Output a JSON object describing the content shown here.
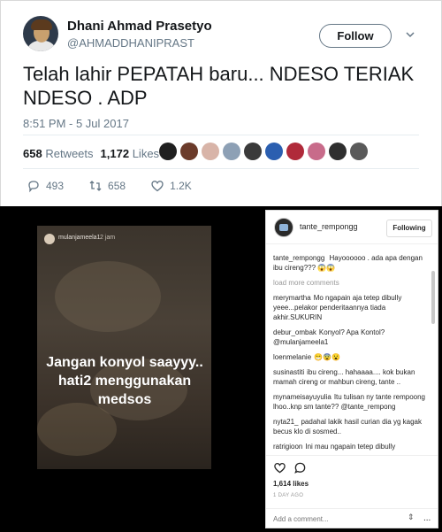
{
  "tweet": {
    "name": "Dhani Ahmad Prasetyo",
    "handle": "@AHMADDHANIPRAST",
    "follow_label": "Follow",
    "text": "Telah lahir PEPATAH baru... NDESO TERIAK NDESO . ADP",
    "timestamp": "8:51 PM - 5 Jul 2017",
    "retweets_count": "658",
    "retweets_label": "Retweets",
    "likes_count": "1,172",
    "likes_label": "Likes",
    "reply_count": "493",
    "retweet_count": "658",
    "like_count": "1.2K",
    "liker_colors": [
      "#1f1f1f",
      "#6b3b2a",
      "#d8b4a8",
      "#8da0b5",
      "#3a3a3a",
      "#2b5fb0",
      "#b02a3a",
      "#c86b8a",
      "#2f2f2f",
      "#5a5a5a"
    ]
  },
  "story": {
    "user": "mulanjameela1",
    "time": "2 jam",
    "text": "Jangan konyol saayyy.. hati2 menggunakan medsos"
  },
  "instagram": {
    "user": "tante_rempongg",
    "following_label": "Following",
    "first_comment": {
      "user": "tante_rempongg",
      "text": "Hayoooooo . ada apa dengan ibu cireng??? 😱😱"
    },
    "load_more": "load more comments",
    "comments": [
      {
        "user": "merymartha",
        "text": "Mo ngapain aja tetep dibully yeee...pelakor penderitaannya tiada akhir.SUKURIN"
      },
      {
        "user": "debur_ombak",
        "text": "Konyol? Apa Kontol? @mulanjameela1"
      },
      {
        "user": "loenmelanie",
        "text": "😁😨😮"
      },
      {
        "user": "susinastiti",
        "text": "ibu cireng... hahaaaa.... kok bukan mamah cireng or mahbun cireng, tante .."
      },
      {
        "user": "mynameisayuyulia",
        "text": "Itu tulisan ny tante rempoong lhoo..knp sm tante?? @tante_rempong"
      },
      {
        "user": "nyta21_",
        "text": "padahal lakik hasil curian dia yg kagak becus klo di sosmed.."
      },
      {
        "user": "ratrigioon",
        "text": "Ini mau ngapain tetep dibully"
      }
    ],
    "likes": "1,614 likes",
    "date": "1 DAY AGO",
    "add_comment_placeholder": "Add a comment...",
    "more": "..."
  }
}
